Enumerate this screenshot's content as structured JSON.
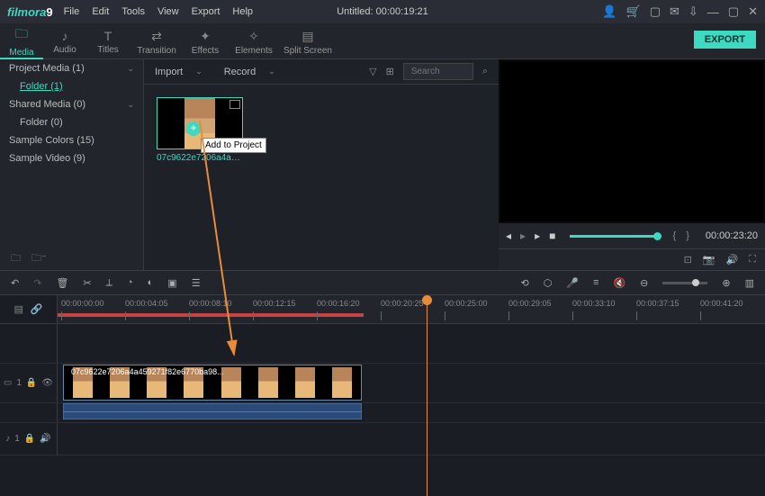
{
  "app": {
    "logo": "filmora",
    "logo_suffix": "9"
  },
  "menu": {
    "file": "File",
    "edit": "Edit",
    "tools": "Tools",
    "view": "View",
    "export": "Export",
    "help": "Help"
  },
  "title": "Untitled:  00:00:19:21",
  "tabs": {
    "media": "Media",
    "audio": "Audio",
    "titles": "Titles",
    "transition": "Transition",
    "effects": "Effects",
    "elements": "Elements",
    "split": "Split Screen"
  },
  "export_btn": "EXPORT",
  "sidebar": {
    "project_media": "Project Media (1)",
    "folder1": "Folder (1)",
    "shared_media": "Shared Media (0)",
    "folder0": "Folder (0)",
    "sample_colors": "Sample Colors (15)",
    "sample_video": "Sample Video (9)"
  },
  "browser": {
    "import": "Import",
    "record": "Record",
    "search_placeholder": "Search",
    "clip_name": "07c9622e7206a4a4592...",
    "tooltip": "Add to Project"
  },
  "preview": {
    "timecode": "00:00:23:20"
  },
  "ruler": {
    "ticks": [
      "00:00:00:00",
      "00:00:04:05",
      "00:00:08:10",
      "00:00:12:15",
      "00:00:16:20",
      "00:00:20:25",
      "00:00:25:00",
      "00:00:29:05",
      "00:00:33:10",
      "00:00:37:15",
      "00:00:41:20"
    ]
  },
  "tracks": {
    "video_label": "1",
    "audio_label": "1",
    "clip_label": "07c9622e7206a4a459271f82e6770ba98..."
  }
}
